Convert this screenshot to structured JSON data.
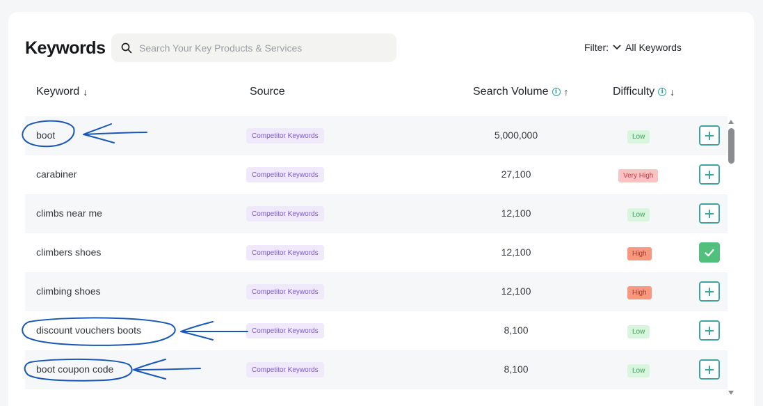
{
  "header": {
    "title": "Keywords",
    "search_placeholder": "Search Your Key Products & Services",
    "filter_label": "Filter:",
    "filter_value": "All Keywords"
  },
  "columns": {
    "keyword": "Keyword",
    "source": "Source",
    "search_volume": "Search Volume",
    "difficulty": "Difficulty"
  },
  "colors": {
    "accent": "#3aa79f",
    "source_badge": "#7c55d6",
    "annotation_ink": "#1857b5"
  },
  "rows": [
    {
      "keyword": "boot",
      "source": "Competitor Keywords",
      "volume": "5,000,000",
      "difficulty": "Low",
      "action": "add"
    },
    {
      "keyword": "carabiner",
      "source": "Competitor Keywords",
      "volume": "27,100",
      "difficulty": "Very High",
      "action": "add"
    },
    {
      "keyword": "climbs near me",
      "source": "Competitor Keywords",
      "volume": "12,100",
      "difficulty": "Low",
      "action": "add"
    },
    {
      "keyword": "climbers shoes",
      "source": "Competitor Keywords",
      "volume": "12,100",
      "difficulty": "High",
      "action": "added"
    },
    {
      "keyword": "climbing shoes",
      "source": "Competitor Keywords",
      "volume": "12,100",
      "difficulty": "High",
      "action": "add"
    },
    {
      "keyword": "discount vouchers boots",
      "source": "Competitor Keywords",
      "volume": "8,100",
      "difficulty": "Low",
      "action": "add"
    },
    {
      "keyword": "boot coupon code",
      "source": "Competitor Keywords",
      "volume": "8,100",
      "difficulty": "Low",
      "action": "add"
    }
  ]
}
